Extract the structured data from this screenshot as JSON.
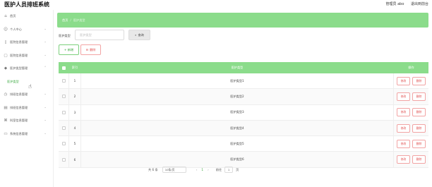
{
  "header": {
    "title": "医护人员排班系统",
    "user": "管理员 abo",
    "logout": "退出到前台"
  },
  "sidebar": {
    "items": [
      {
        "label": "首页",
        "icon": "home-icon"
      },
      {
        "label": "个人中心",
        "icon": "person-icon"
      },
      {
        "label": "医院信息管理",
        "icon": "hospital-icon"
      },
      {
        "label": "医院信息管理",
        "icon": "hospital-info-icon"
      },
      {
        "label": "医护类型管理",
        "icon": "staff-type-icon"
      },
      {
        "label": "医护类型",
        "icon": ""
      },
      {
        "label": "排班信息管理",
        "icon": "schedule-icon"
      },
      {
        "label": "排班信息管理",
        "icon": "shift-icon"
      },
      {
        "label": "科室信息管理",
        "icon": "department-icon"
      },
      {
        "label": "系统信息管理",
        "icon": "system-icon"
      }
    ]
  },
  "breadcrumb": {
    "home": "首页",
    "current": "医护类型"
  },
  "search": {
    "label": "医护类型",
    "placeholder": "医护类型",
    "button": "查询"
  },
  "toolbar": {
    "add": "+ 新增",
    "delete": "删除"
  },
  "table": {
    "headers": {
      "index": "索引",
      "name": "医护类型",
      "actions": "操作"
    },
    "rows": [
      {
        "index": "1",
        "name": "医护类型1",
        "edit": "修改",
        "delete": "删除"
      },
      {
        "index": "2",
        "name": "医护类型2",
        "edit": "修改",
        "delete": "删除"
      },
      {
        "index": "3",
        "name": "医护类型3",
        "edit": "修改",
        "delete": "删除"
      },
      {
        "index": "4",
        "name": "医护类型4",
        "edit": "修改",
        "delete": "删除"
      },
      {
        "index": "5",
        "name": "医护类型5",
        "edit": "修改",
        "delete": "删除"
      },
      {
        "index": "6",
        "name": "医护类型6",
        "edit": "修改",
        "delete": "删除"
      }
    ]
  },
  "pagination": {
    "total": "共 6 条",
    "page_size": "10条/页",
    "prev": "‹",
    "current": "1",
    "next": "›",
    "goto": "前往",
    "goto_value": "1",
    "page_unit": "页"
  },
  "colors": {
    "accent": "#8bdc8b",
    "accent_text": "#3aa93f",
    "danger": "#e05050"
  }
}
